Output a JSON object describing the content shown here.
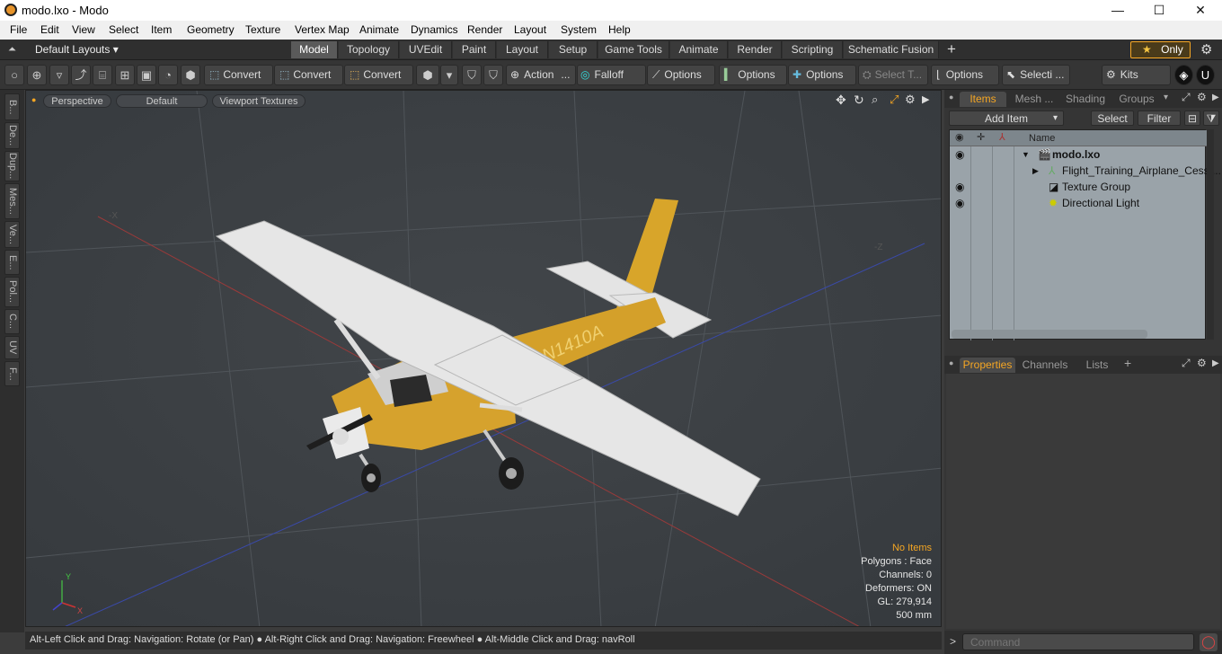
{
  "window": {
    "title": "modo.lxo - Modo",
    "minimize": "—",
    "maximize": "☐",
    "close": "✕"
  },
  "menu": [
    "File",
    "Edit",
    "View",
    "Select",
    "Item",
    "Geometry",
    "Texture",
    "Vertex Map",
    "Animate",
    "Dynamics",
    "Render",
    "Layout",
    "System",
    "Help"
  ],
  "layoutbar": {
    "layouts_label": "Default Layouts ▾",
    "tabs": [
      "Model",
      "Topology",
      "UVEdit",
      "Paint",
      "Layout",
      "Setup",
      "Game Tools",
      "Animate",
      "Render",
      "Scripting",
      "Schematic Fusion"
    ],
    "active_tab": "Model",
    "add": "+",
    "only_label": "Only",
    "star": "★",
    "gear": "⚙"
  },
  "toolbar": {
    "convert1": "Convert",
    "convert2": "Convert",
    "convert3": "Convert",
    "action": "Action",
    "falloff": "Falloff",
    "options1": "Options",
    "options2": "Options",
    "options3": "Options",
    "select_t": "Select T...",
    "options4": "Options",
    "selecti": "Selecti ...",
    "kits": "Kits",
    "ellipsis": "..."
  },
  "leftstrip": [
    "B...",
    "De...",
    "Dup...",
    "Mes...",
    "Ve...",
    "E...",
    "Pol...",
    "C...",
    "UV",
    "F..."
  ],
  "viewport": {
    "mode": "Perspective",
    "style": "Default",
    "shading": "Viewport Textures",
    "info": {
      "no_items": "No Items",
      "polygons": "Polygons : Face",
      "channels": "Channels: 0",
      "deformers": "Deformers: ON",
      "gl": "GL: 279,914",
      "scale": "500 mm"
    },
    "axis_labels": {
      "x": "X",
      "y": "Y",
      "neg_x": "-X",
      "neg_z": "-Z"
    },
    "tail_number": "N1410A"
  },
  "statusbar": "Alt-Left Click and Drag: Navigation: Rotate (or Pan) ● Alt-Right Click and Drag: Navigation: Freewheel ● Alt-Middle Click and Drag: navRoll",
  "items_panel": {
    "tabs": [
      "Items",
      "Mesh ...",
      "Shading",
      "Groups"
    ],
    "add_item": "Add Item",
    "select": "Select",
    "filter": "Filter",
    "column_name": "Name",
    "rows": [
      {
        "label": "modo.lxo",
        "bold": true
      },
      {
        "label": "Flight_Training_Airplane_Cess ..."
      },
      {
        "label": "Texture Group"
      },
      {
        "label": "Directional Light"
      }
    ]
  },
  "properties_panel": {
    "tabs": [
      "Properties",
      "Channels",
      "Lists"
    ],
    "add": "+"
  },
  "command": {
    "placeholder": "Command",
    "prompt": ">"
  }
}
